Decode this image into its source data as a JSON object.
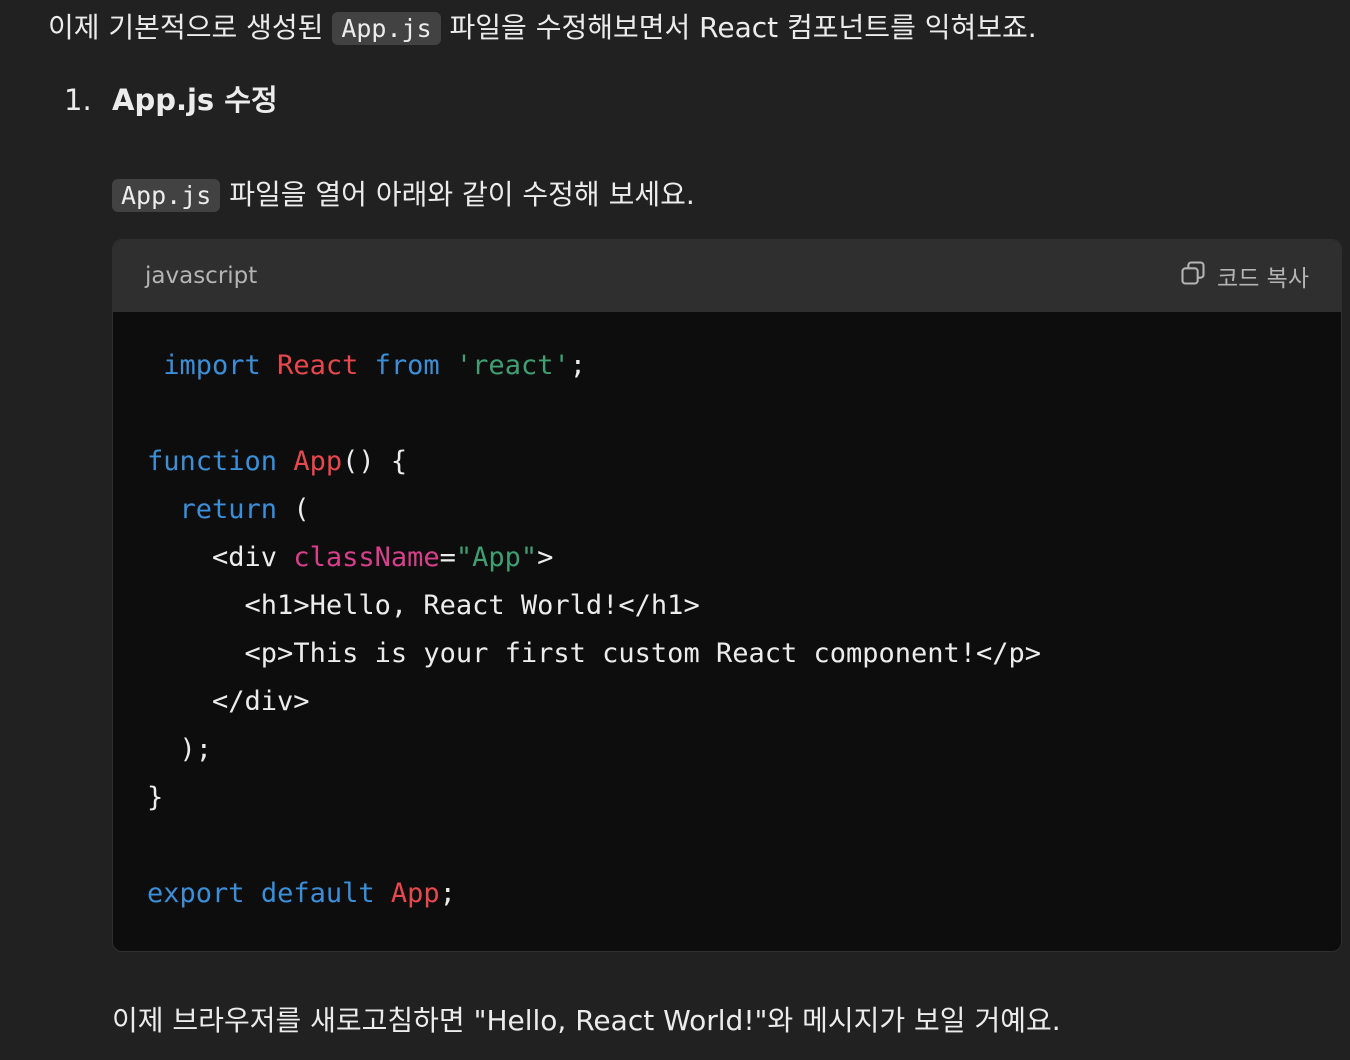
{
  "intro": {
    "before": "이제 기본적으로 생성된 ",
    "code": "App.js",
    "after": " 파일을 수정해보면서 React 컴포넌트를 익혀보죠."
  },
  "step": {
    "number": "1.",
    "title": "App.js 수정"
  },
  "instruction": {
    "code": "App.js",
    "after": " 파일을 열어 아래와 같이 수정해 보세요."
  },
  "codeblock": {
    "language": "javascript",
    "copy_label": "코드 복사",
    "copy_icon": "copy-icon",
    "tokens": {
      "import": "import",
      "react_id": "React",
      "from": "from",
      "react_str": "'react'",
      "semi": ";",
      "function": "function",
      "app_name": "App",
      "fn_sig": "() {",
      "return": "return",
      "paren_open": "(",
      "div_open": "<div ",
      "classname": "className",
      "eq": "=",
      "app_str": "\"App\"",
      "gt": ">",
      "h1_line": "<h1>Hello, React World!</h1>",
      "p_line": "<p>This is your first custom React component!</p>",
      "div_close": "</div>",
      "paren_close": ");",
      "brace_close": "}",
      "export": "export",
      "default": "default",
      "app_export": "App",
      "semi_end": ";"
    }
  },
  "outro": {
    "text": "이제 브라우저를 새로고침하면 \"Hello, React World!\"와 메시지가 보일 거예요."
  },
  "colors": {
    "background": "#212121",
    "code_bg": "#0d0d0d",
    "header_bg": "#2f2f2f",
    "keyword": "#3b8ed8",
    "identifier": "#e5484d",
    "string": "#3f9f72",
    "attribute": "#d6408a"
  }
}
